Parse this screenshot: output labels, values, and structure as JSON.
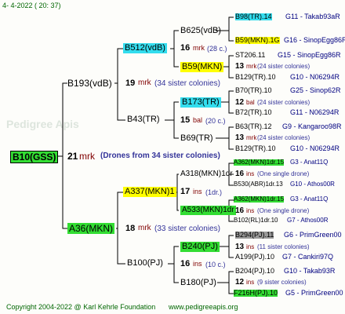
{
  "header": {
    "date": "4-  4-2022 ( 20: 37)"
  },
  "footer": {
    "copyright": "Copyright 2004-2022 @ Karl Kehrle Foundation",
    "url": "www.pedigreeapis.org"
  },
  "root": {
    "name": "B10(GSS)",
    "num": "21",
    "mark": "mrk",
    "drones": "(Drones from 34 sister colonies)"
  },
  "gen1": {
    "top": {
      "name": "B193(vdB)",
      "num": "19",
      "mark": "mrk",
      "note": "(34 sister colonies)"
    },
    "bot": {
      "name": "A36(MKN)",
      "num": "18",
      "mark": "mrk",
      "note": "(33 sister colonies)"
    }
  },
  "gen2": {
    "a": {
      "name": "B512(vdB)",
      "num": "16",
      "mark": "mrk",
      "note": "(28 c.)"
    },
    "b": {
      "name": "B43(TR)",
      "num": "15",
      "mark": "bal",
      "note": "(20 c.)"
    },
    "c": {
      "name": "A337(MKN)1",
      "num": "17",
      "mark": "ins",
      "note": "(1dr.)"
    },
    "d": {
      "name": "B100(PJ)",
      "num": "16",
      "mark": "ins",
      "note": "(10 c.)"
    }
  },
  "gen3": [
    {
      "name": "B625(vdB)",
      "num": "16",
      "mark": "mrk",
      "note": "(28 c.)"
    },
    {
      "name": "B59(MKN)",
      "num": "13",
      "mark": "mrk",
      "note": "(24 sister colonies)"
    },
    {
      "name": "B173(TR)",
      "num": "12",
      "mark": "bal",
      "note": "(24 sister colonies)"
    },
    {
      "name": "B69(TR)",
      "num": "13",
      "mark": "mrk",
      "note": "(24 sister colonies)"
    },
    {
      "name": "A318(MKN)1dr",
      "num": "16",
      "mark": "ins",
      "note": "(One single drone)"
    },
    {
      "name": "A533(MKN)1dr",
      "num": "16",
      "mark": "ins",
      "note": "(One single drone)"
    },
    {
      "name": "B240(PJ)",
      "num": "13",
      "mark": "ins",
      "note": "(11 sister colonies)"
    },
    {
      "name": "B180(PJ)",
      "num": "12",
      "mark": "ins",
      "note": "(9 sister colonies)"
    }
  ],
  "gen4": [
    {
      "name": "B98(TR).14",
      "info": "G11 - Takab93aR"
    },
    {
      "name": "B59(MKN).1G",
      "info": "G16 - SinopEgg86R"
    },
    {
      "name": "ST206.11",
      "info": "G15 - SinopEgg86R"
    },
    {
      "name": "B129(TR).10",
      "info": "G10 - N06294R"
    },
    {
      "name": "B70(TR).10",
      "info": "G25 - Sinop62R"
    },
    {
      "name": "B72(TR).10",
      "info": "G11 - N06294R"
    },
    {
      "name": "B63(TR).12",
      "info": "G9 - Kangaroo98R"
    },
    {
      "name": "B129(TR).10",
      "info": "G10 - N06294R"
    },
    {
      "name": "A362(MKN)1dr.15",
      "info": "G3 - Anat11Q"
    },
    {
      "name": "B530(ABR)1dr.13",
      "info": "G10 - Athos00R"
    },
    {
      "name": "A362(MKN)1dr.15",
      "info": "G3 - Anat11Q"
    },
    {
      "name": "B102(RL)1dr.10",
      "info": "G7 - Athos00R"
    },
    {
      "name": "B294(PJ).11",
      "info": "G6 - PrimGreen00"
    },
    {
      "name": "A199(PJ).10",
      "info": "G7 - Cankiri97Q"
    },
    {
      "name": "B204(PJ).10",
      "info": "G10 - Takab93R"
    },
    {
      "name": "F216H(PJ).10",
      "info": "G5 - PrimGreen00"
    }
  ]
}
